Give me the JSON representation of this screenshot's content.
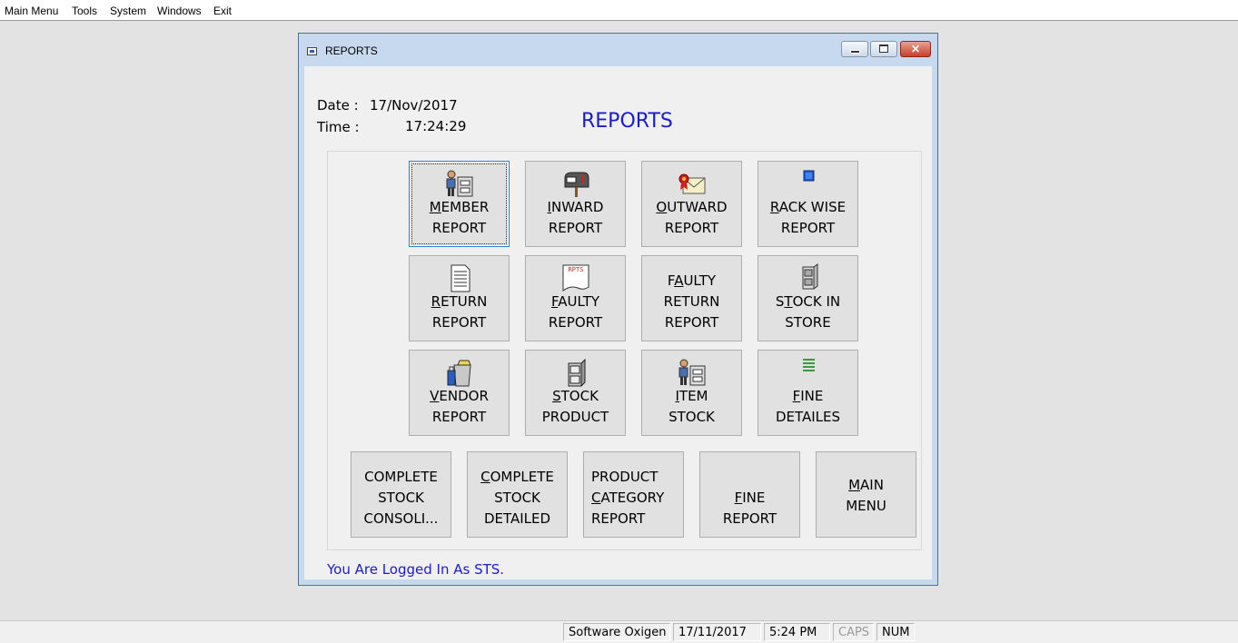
{
  "menubar": {
    "items": [
      "Main Menu",
      "Tools",
      "System",
      "Windows",
      "Exit"
    ]
  },
  "window": {
    "title": "REPORTS",
    "date_label": "Date :",
    "date_value": "17/Nov/2017",
    "time_label": "Time :",
    "time_value": "17:24:29",
    "heading": "REPORTS",
    "logged_in_text": "You Are Logged In As STS."
  },
  "buttons": [
    {
      "id": "member-report",
      "l1": [
        "",
        "M",
        "EMBER"
      ],
      "l2": "REPORT",
      "icon": "person-at-file-cabinet-icon"
    },
    {
      "id": "inward-report",
      "l1": [
        "",
        "I",
        "NWARD"
      ],
      "l2": "REPORT",
      "icon": "mailbox-icon"
    },
    {
      "id": "outward-report",
      "l1": [
        "",
        "O",
        "UTWARD"
      ],
      "l2": "REPORT",
      "icon": "certificate-envelope-icon"
    },
    {
      "id": "rack-wise-report",
      "l1": [
        "",
        "R",
        "ACK WISE"
      ],
      "l2": "REPORT",
      "icon": "blue-square-icon"
    },
    {
      "id": "return-report",
      "l1": [
        "",
        "R",
        "ETURN"
      ],
      "l2": "REPORT",
      "icon": "document-icon"
    },
    {
      "id": "faulty-report",
      "l1": [
        "",
        "F",
        "AULTY"
      ],
      "l2": "REPORT",
      "icon": "rpts-document-icon"
    },
    {
      "id": "faulty-return-report",
      "l0": [
        "F",
        "A",
        "ULTY"
      ],
      "l1": [
        "",
        "",
        "RETURN"
      ],
      "l2": "REPORT",
      "icon": ""
    },
    {
      "id": "stock-in-store",
      "l1": [
        "S",
        "T",
        "OCK IN"
      ],
      "l2": "STORE",
      "icon": "file-cabinet-icon"
    },
    {
      "id": "vendor-report",
      "l1": [
        "",
        "V",
        "ENDOR"
      ],
      "l2": "REPORT",
      "icon": "trash-bin-icon"
    },
    {
      "id": "stock-product",
      "l1": [
        "",
        "S",
        "TOCK"
      ],
      "l2": "PRODUCT",
      "icon": "filing-cabinet-icon"
    },
    {
      "id": "item-stock",
      "l1": [
        "",
        "I",
        "TEM"
      ],
      "l2": "STOCK",
      "icon": "person-at-file-cabinet-icon"
    },
    {
      "id": "fine-detailes",
      "l1": [
        "",
        "F",
        "INE"
      ],
      "l2": "DETAILES",
      "icon": "green-list-icon"
    }
  ],
  "bottom_buttons": [
    {
      "id": "complete-stock-consoli",
      "lines": [
        [
          "",
          "",
          "COMPLETE"
        ],
        [
          "",
          "",
          "STOCK"
        ],
        [
          "",
          "",
          "CONSOLI..."
        ]
      ]
    },
    {
      "id": "complete-stock-detailed",
      "lines": [
        [
          "",
          "C",
          "OMPLETE"
        ],
        [
          "",
          "",
          "STOCK"
        ],
        [
          "",
          "",
          "DETAILED"
        ]
      ]
    },
    {
      "id": "product-category-report",
      "lines": [
        [
          "",
          "",
          "PRODUCT"
        ],
        [
          "",
          "C",
          "ATEGORY"
        ],
        [
          "",
          "",
          "REPORT"
        ]
      ]
    },
    {
      "id": "fine-report",
      "lines": [
        [
          "",
          "F",
          "INE"
        ],
        [
          "",
          "",
          "REPORT"
        ]
      ]
    },
    {
      "id": "main-menu",
      "lines": [
        [
          "",
          "M",
          "AIN"
        ],
        [
          "",
          "",
          "MENU"
        ]
      ]
    }
  ],
  "statusbar": {
    "app": "Software Oxigen",
    "date": "17/11/2017",
    "time": "5:24 PM",
    "caps": "CAPS",
    "num": "NUM"
  }
}
